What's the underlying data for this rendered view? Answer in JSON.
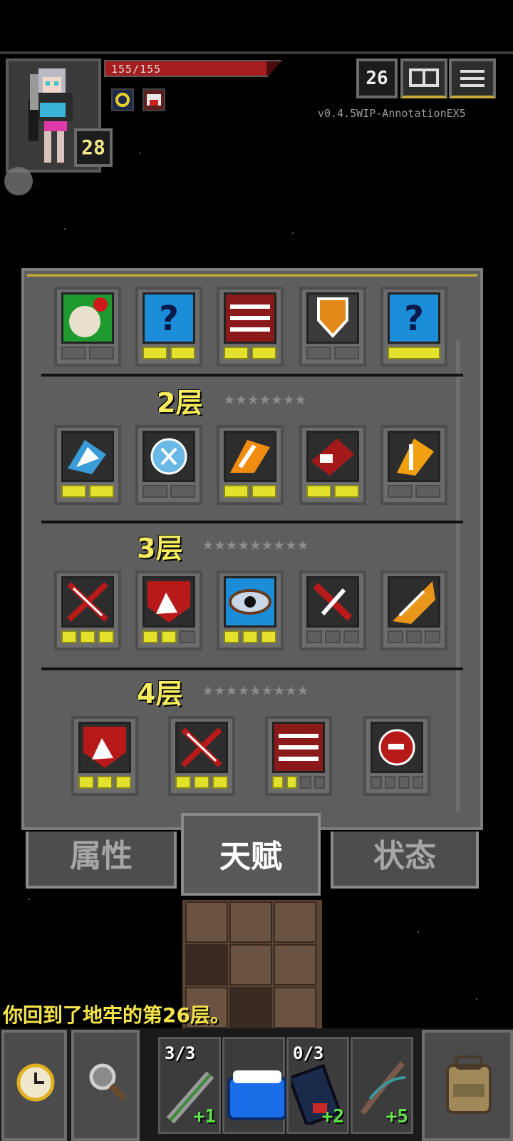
{
  "hud": {
    "hp_text": "155/155",
    "hp_fraction": 1.0,
    "level": "28",
    "depth": "26",
    "version": "v0.4.5WIP-AnnotationEX5",
    "buffs": [
      "halo-buff-icon",
      "red-buff-icon"
    ]
  },
  "talents": {
    "tier1_points": [
      [
        0,
        0
      ],
      [
        1,
        1
      ],
      [
        1,
        1
      ],
      [
        0,
        0
      ],
      [
        2
      ]
    ],
    "tiers": [
      {
        "label": "2层",
        "stars": "★★★★★★★",
        "points": [
          [
            1,
            1
          ],
          [
            0,
            0
          ],
          [
            1,
            1
          ],
          [
            1,
            1
          ],
          [
            0,
            0
          ]
        ]
      },
      {
        "label": "3层",
        "stars": "★★★★★★★★★",
        "points": [
          [
            1,
            1,
            1
          ],
          [
            1,
            1,
            0
          ],
          [
            1,
            1,
            1
          ],
          [
            0,
            0,
            0
          ],
          [
            0,
            0,
            0
          ]
        ]
      },
      {
        "label": "4层",
        "stars": "★★★★★★★★★",
        "points": [
          [
            1,
            1,
            1
          ],
          [
            1,
            1,
            1
          ],
          [
            1,
            1,
            0,
            0
          ],
          [
            0,
            0,
            0,
            0
          ]
        ]
      }
    ]
  },
  "tabs": {
    "attributes": "属性",
    "talents": "天赋",
    "status": "状态",
    "active": "talents"
  },
  "log": {
    "message": "你回到了地牢的第26层。"
  },
  "quickslots": [
    {
      "count": "3/3",
      "bonus": "+1"
    },
    {
      "count": "",
      "bonus": ""
    },
    {
      "count": "0/3",
      "bonus": "+2"
    },
    {
      "count": "",
      "bonus": "+5"
    }
  ],
  "colors": {
    "accent_yellow": "#f6ec5e",
    "hp_red": "#a51d1d",
    "bonus_green": "#5fe24a"
  }
}
